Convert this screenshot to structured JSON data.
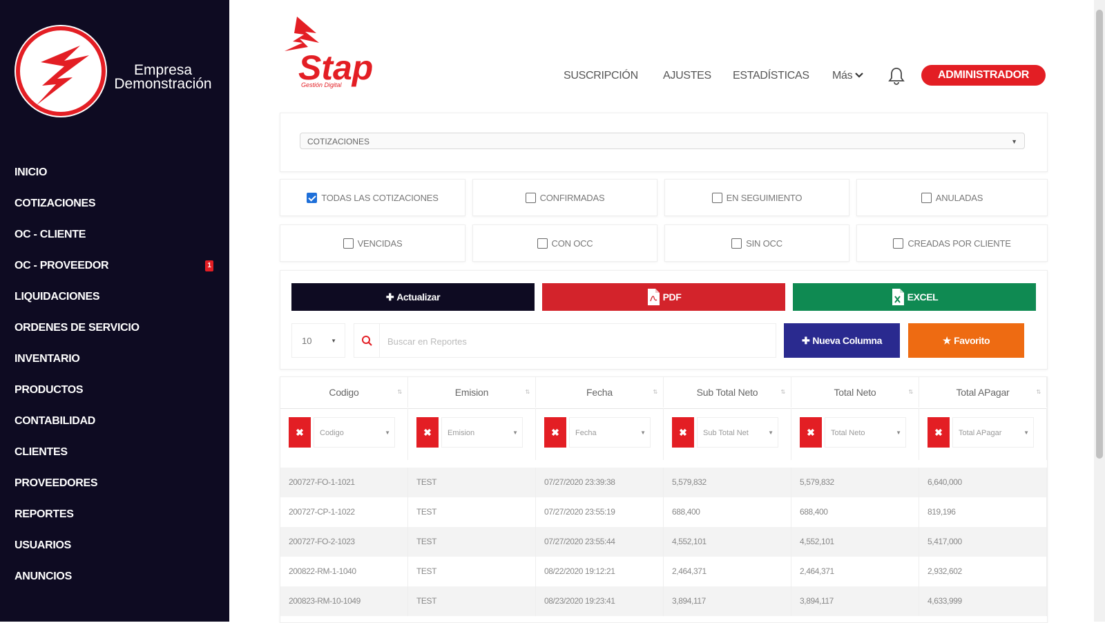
{
  "sidebar": {
    "company_name": [
      "Empresa",
      "Demonstración"
    ],
    "nav": [
      {
        "label": "INICIO"
      },
      {
        "label": "COTIZACIONES"
      },
      {
        "label": "OC - CLIENTE"
      },
      {
        "label": "OC - PROVEEDOR",
        "badge": "1"
      },
      {
        "label": "LIQUIDACIONES"
      },
      {
        "label": "ORDENES DE SERVICIO"
      },
      {
        "label": "INVENTARIO"
      },
      {
        "label": "PRODUCTOS"
      },
      {
        "label": "CONTABILIDAD"
      },
      {
        "label": "CLIENTES"
      },
      {
        "label": "PROVEEDORES"
      },
      {
        "label": "REPORTES"
      },
      {
        "label": "USUARIOS"
      },
      {
        "label": "ANUNCIOS"
      }
    ]
  },
  "brand": {
    "name": "Stap",
    "tagline": "Gestión Digital"
  },
  "topnav": {
    "links": [
      "SUSCRIPCIÓN",
      "AJUSTES",
      "ESTADÍSTICAS",
      "Más"
    ],
    "admin_label": "ADMINISTRADOR"
  },
  "report": {
    "selected": "COTIZACIONES"
  },
  "filters": [
    {
      "label": "TODAS LAS COTIZACIONES",
      "checked": true
    },
    {
      "label": "CONFIRMADAS",
      "checked": false
    },
    {
      "label": "EN SEGUIMIENTO",
      "checked": false
    },
    {
      "label": "ANULADAS",
      "checked": false
    },
    {
      "label": "VENCIDAS",
      "checked": false
    },
    {
      "label": "CON OCC",
      "checked": false
    },
    {
      "label": "SIN OCC",
      "checked": false
    },
    {
      "label": "CREADAS POR CLIENTE",
      "checked": false
    }
  ],
  "actions": {
    "update": "Actualizar",
    "pdf": "PDF",
    "excel": "EXCEL",
    "new_column": "Nueva Columna",
    "favorite": "Favorito",
    "page_length": "10",
    "search_placeholder": "Buscar en Reportes"
  },
  "colors": {
    "brand_red": "#e31e24",
    "sidebar_bg": "#0e0b22",
    "excel_green": "#0f8a52",
    "navy": "#2a2a8f",
    "orange": "#ee6b12",
    "check_blue": "#1e6fd9"
  },
  "table": {
    "headers": [
      "Codigo",
      "Emision",
      "Fecha",
      "Sub Total Neto",
      "Total Neto",
      "Total APagar"
    ],
    "column_filters": [
      "Codigo",
      "Emision",
      "Fecha",
      "Sub Total Net",
      "Total Neto",
      "Total APagar"
    ],
    "rows": [
      [
        "200727-FO-1-1021",
        "TEST",
        "07/27/2020 23:39:38",
        "5,579,832",
        "5,579,832",
        "6,640,000"
      ],
      [
        "200727-CP-1-1022",
        "TEST",
        "07/27/2020 23:55:19",
        "688,400",
        "688,400",
        "819,196"
      ],
      [
        "200727-FO-2-1023",
        "TEST",
        "07/27/2020 23:55:44",
        "4,552,101",
        "4,552,101",
        "5,417,000"
      ],
      [
        "200822-RM-1-1040",
        "TEST",
        "08/22/2020 19:12:21",
        "2,464,371",
        "2,464,371",
        "2,932,602"
      ],
      [
        "200823-RM-10-1049",
        "TEST",
        "08/23/2020 19:23:41",
        "3,894,117",
        "3,894,117",
        "4,633,999"
      ]
    ]
  }
}
